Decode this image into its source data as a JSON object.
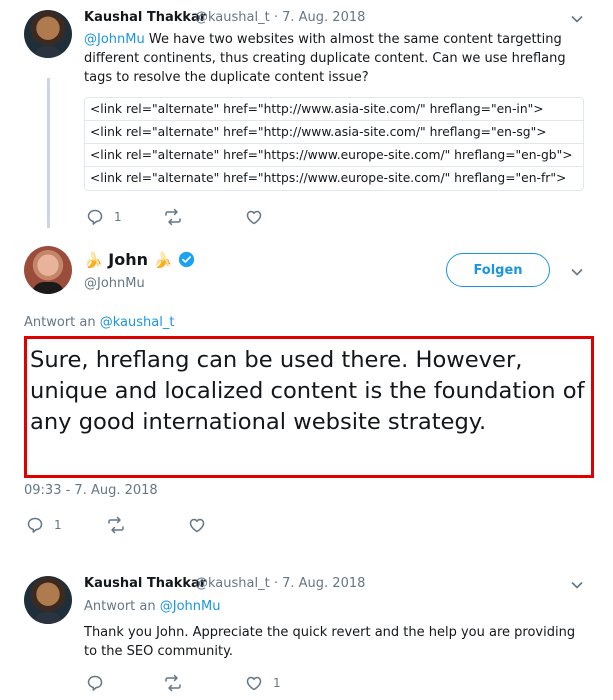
{
  "tweet1": {
    "name": "Kaushal Thakkar",
    "handle": "@kaushal_t",
    "sep": "·",
    "date": "7. Aug. 2018",
    "mention": "@JohnMu",
    "text": " We have two websites with almost the same content targetting different continents, thus creating duplicate content. Can we use hreflang tags to resolve the duplicate content issue?",
    "code_lines": [
      "<link rel=\"alternate\" href=\"http://www.asia-site.com/\" hreflang=\"en-in\">",
      "<link rel=\"alternate\" href=\"http://www.asia-site.com/\" hreflang=\"en-sg\">",
      "<link rel=\"alternate\" href=\"https://www.europe-site.com/\" hreflang=\"en-gb\">",
      "<link rel=\"alternate\" href=\"https://www.europe-site.com/\" hreflang=\"en-fr\">"
    ],
    "reply_count": "1"
  },
  "tweet2": {
    "name": "John",
    "handle": "@JohnMu",
    "follow_label": "Folgen",
    "reply_prefix": "Antwort an ",
    "reply_to": "@kaushal_t",
    "text": "Sure, hreflang can be used there. However, unique and localized content is the foundation of any good international website strategy.",
    "timestamp": "09:33 - 7. Aug. 2018",
    "reply_count": "1"
  },
  "tweet3": {
    "name": "Kaushal Thakkar",
    "handle": "@kaushal_t",
    "sep": "·",
    "date": "7. Aug. 2018",
    "reply_prefix": "Antwort an ",
    "reply_to": "@JohnMu",
    "text": "Thank you John. Appreciate the quick revert and the help you are providing to the SEO community.",
    "like_count": "1"
  },
  "colors": {
    "link": "#1b95e0",
    "muted": "#657786",
    "highlight_border": "#e00000"
  }
}
